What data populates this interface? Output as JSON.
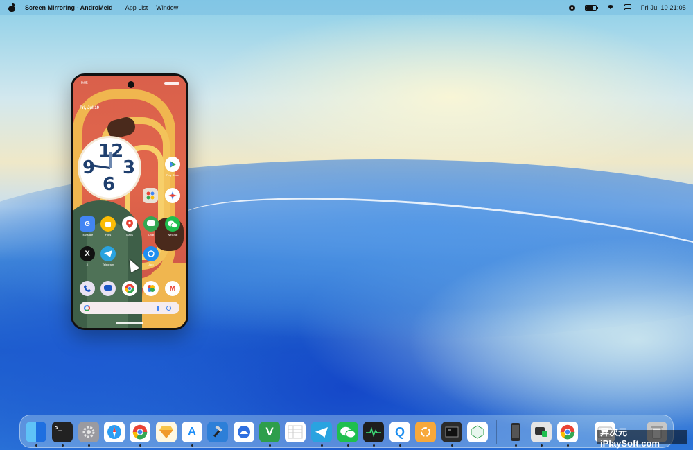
{
  "menubar": {
    "app_name": "Screen Mirroring - AndroMeld",
    "items": [
      "App List",
      "Window"
    ],
    "datetime": "Fri Jul 10  21:05"
  },
  "phone": {
    "status_time": "9:05",
    "date": "Fri, Jul 10",
    "clock_digits": [
      "12",
      "9",
      "3",
      "6"
    ],
    "apps": [
      {
        "name": "Play Store",
        "icon": "play-store-icon"
      },
      {
        "name": "Google",
        "icon": "google-folder-icon"
      },
      {
        "name": "Games",
        "icon": "games-icon"
      },
      {
        "name": "Translate",
        "icon": "translate-icon"
      },
      {
        "name": "Files",
        "icon": "files-icon"
      },
      {
        "name": "Maps",
        "icon": "maps-icon"
      },
      {
        "name": "Chat",
        "icon": "chat-icon"
      },
      {
        "name": "WeChat",
        "icon": "wechat-icon"
      },
      {
        "name": "X",
        "icon": "x-icon"
      },
      {
        "name": "Telegram",
        "icon": "telegram-icon"
      },
      {
        "name": "App",
        "icon": "app-icon"
      },
      {
        "name": "Phone",
        "icon": "phone-icon"
      },
      {
        "name": "Messages",
        "icon": "messages-icon"
      },
      {
        "name": "Chrome",
        "icon": "chrome-icon"
      },
      {
        "name": "Photos",
        "icon": "photos-icon"
      },
      {
        "name": "Gmail",
        "icon": "gmail-icon"
      }
    ],
    "labels": {
      "play": "Play Store",
      "translate": "Translate",
      "files": "Files",
      "maps": "Maps",
      "chat": "Chat",
      "wechat": "WeChat",
      "x": "X",
      "telegram": "Telegram",
      "app": "App"
    },
    "icon_text": {
      "x": "X",
      "gmail": "M",
      "chat_x": "X"
    }
  },
  "dock": {
    "icons": [
      {
        "name": "finder",
        "icon": "finder-icon",
        "color": "#1e8ff0"
      },
      {
        "name": "terminal",
        "icon": "terminal-icon",
        "color": "#222222"
      },
      {
        "name": "system-settings",
        "icon": "gear-icon",
        "color": "#8e8e93"
      },
      {
        "name": "safari",
        "icon": "safari-icon",
        "color": "#2a9df4"
      },
      {
        "name": "chrome",
        "icon": "chrome-icon",
        "color": "#ffffff"
      },
      {
        "name": "sketch",
        "icon": "sketch-icon",
        "color": "#f7c548"
      },
      {
        "name": "app-store",
        "icon": "app-store-icon",
        "color": "#1c8ef9"
      },
      {
        "name": "xcode",
        "icon": "hammer-icon",
        "color": "#2d7fd8"
      },
      {
        "name": "app",
        "icon": "app-icon",
        "color": "#ffffff"
      },
      {
        "name": "vim",
        "icon": "vim-icon",
        "color": "#2e9e4b"
      },
      {
        "name": "notes",
        "icon": "notes-icon",
        "color": "#ffffff"
      },
      {
        "name": "telegram",
        "icon": "telegram-icon",
        "color": "#2aa3e0"
      },
      {
        "name": "wechat",
        "icon": "wechat-icon",
        "color": "#1fbf4e"
      },
      {
        "name": "activity-monitor",
        "icon": "activity-icon",
        "color": "#1e1e1e"
      },
      {
        "name": "qq",
        "icon": "q-icon",
        "color": "#1e8ff0"
      },
      {
        "name": "recycle",
        "icon": "recycle-icon",
        "color": "#f7a83b"
      },
      {
        "name": "console",
        "icon": "console-icon",
        "color": "#2b2b2b"
      },
      {
        "name": "app2",
        "icon": "app-icon",
        "color": "#ffffff"
      },
      {
        "name": "phone-device",
        "icon": "phone-device-icon",
        "color": "#2b2b2b"
      },
      {
        "name": "screen-mirror",
        "icon": "mirror-icon",
        "color": "#e5e5e5"
      },
      {
        "name": "chrome2",
        "icon": "chrome-icon",
        "color": "#ffffff"
      },
      {
        "name": "folder",
        "icon": "folder-icon",
        "color": "#ffffff"
      },
      {
        "name": "trash",
        "icon": "trash-icon",
        "color": "#c7c7c7"
      }
    ],
    "labels": {
      "terminal": ">_",
      "vim": "V",
      "qq": "Q",
      "app_store": "A"
    }
  },
  "watermark": "异次元 iPlaySoft.com"
}
